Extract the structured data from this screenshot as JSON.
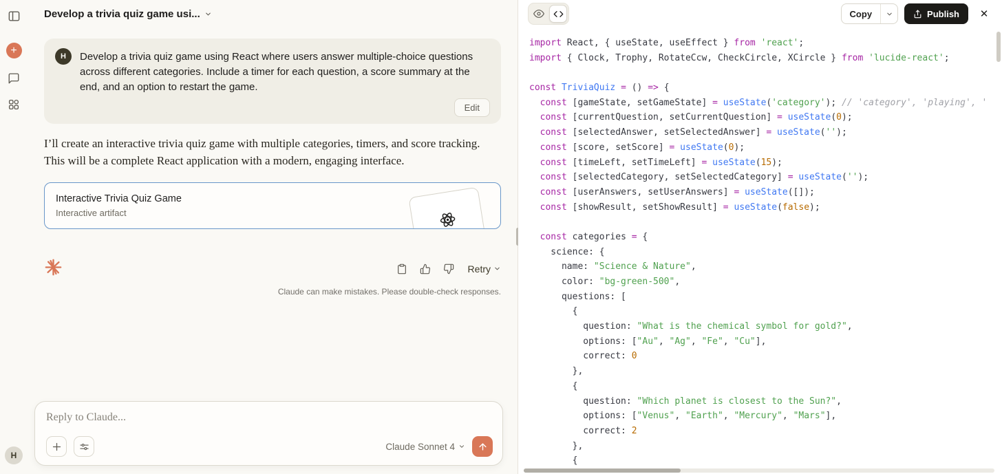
{
  "colors": {
    "accent": "#d97757",
    "artifact_border": "#6896c9",
    "publish_bg": "#1c1b18"
  },
  "icons": {
    "plus": "+",
    "close": "✕"
  },
  "rail": {
    "avatar_initial": "H"
  },
  "header": {
    "title": "Develop a trivia quiz game usi..."
  },
  "user_message": {
    "avatar": "H",
    "text": "Develop a trivia quiz game using React where users answer multiple-choice questions across different categories. Include a timer for each question, a score summary at the end, and an option to restart the game.",
    "edit_label": "Edit"
  },
  "assistant": {
    "intro": "I’ll create an interactive trivia quiz game with multiple categories, timers, and score tracking. This will be a complete React application with a modern, engaging interface.",
    "artifact_card": {
      "title": "Interactive Trivia Quiz Game",
      "subtitle": "Interactive artifact"
    },
    "retry_label": "Retry",
    "disclaimer": "Claude can make mistakes. Please double-check responses."
  },
  "composer": {
    "placeholder": "Reply to Claude...",
    "model": "Claude Sonnet 4"
  },
  "artifact_panel": {
    "copy_label": "Copy",
    "publish_label": "Publish",
    "code_lines": [
      [
        [
          "k",
          "import"
        ],
        [
          "p",
          " React, { useState, useEffect } "
        ],
        [
          "k",
          "from"
        ],
        [
          "p",
          " "
        ],
        [
          "s",
          "'react'"
        ],
        [
          "p",
          ";"
        ]
      ],
      [
        [
          "k",
          "import"
        ],
        [
          "p",
          " { Clock, Trophy, RotateCcw, CheckCircle, XCircle } "
        ],
        [
          "k",
          "from"
        ],
        [
          "p",
          " "
        ],
        [
          "s",
          "'lucide-react'"
        ],
        [
          "p",
          ";"
        ]
      ],
      [],
      [
        [
          "k",
          "const"
        ],
        [
          "p",
          " "
        ],
        [
          "f",
          "TriviaQuiz"
        ],
        [
          "p",
          " "
        ],
        [
          "o",
          "="
        ],
        [
          "p",
          " () "
        ],
        [
          "o",
          "=>"
        ],
        [
          "p",
          " {"
        ]
      ],
      [
        [
          "p",
          "  "
        ],
        [
          "k",
          "const"
        ],
        [
          "p",
          " [gameState, setGameState] "
        ],
        [
          "o",
          "="
        ],
        [
          "p",
          " "
        ],
        [
          "f",
          "useState"
        ],
        [
          "p",
          "("
        ],
        [
          "s",
          "'category'"
        ],
        [
          "p",
          "); "
        ],
        [
          "c",
          "// 'category', 'playing', '"
        ]
      ],
      [
        [
          "p",
          "  "
        ],
        [
          "k",
          "const"
        ],
        [
          "p",
          " [currentQuestion, setCurrentQuestion] "
        ],
        [
          "o",
          "="
        ],
        [
          "p",
          " "
        ],
        [
          "f",
          "useState"
        ],
        [
          "p",
          "("
        ],
        [
          "n",
          "0"
        ],
        [
          "p",
          ");"
        ]
      ],
      [
        [
          "p",
          "  "
        ],
        [
          "k",
          "const"
        ],
        [
          "p",
          " [selectedAnswer, setSelectedAnswer] "
        ],
        [
          "o",
          "="
        ],
        [
          "p",
          " "
        ],
        [
          "f",
          "useState"
        ],
        [
          "p",
          "("
        ],
        [
          "s",
          "''"
        ],
        [
          "p",
          ");"
        ]
      ],
      [
        [
          "p",
          "  "
        ],
        [
          "k",
          "const"
        ],
        [
          "p",
          " [score, setScore] "
        ],
        [
          "o",
          "="
        ],
        [
          "p",
          " "
        ],
        [
          "f",
          "useState"
        ],
        [
          "p",
          "("
        ],
        [
          "n",
          "0"
        ],
        [
          "p",
          ");"
        ]
      ],
      [
        [
          "p",
          "  "
        ],
        [
          "k",
          "const"
        ],
        [
          "p",
          " [timeLeft, setTimeLeft] "
        ],
        [
          "o",
          "="
        ],
        [
          "p",
          " "
        ],
        [
          "f",
          "useState"
        ],
        [
          "p",
          "("
        ],
        [
          "n",
          "15"
        ],
        [
          "p",
          ");"
        ]
      ],
      [
        [
          "p",
          "  "
        ],
        [
          "k",
          "const"
        ],
        [
          "p",
          " [selectedCategory, setSelectedCategory] "
        ],
        [
          "o",
          "="
        ],
        [
          "p",
          " "
        ],
        [
          "f",
          "useState"
        ],
        [
          "p",
          "("
        ],
        [
          "s",
          "''"
        ],
        [
          "p",
          ");"
        ]
      ],
      [
        [
          "p",
          "  "
        ],
        [
          "k",
          "const"
        ],
        [
          "p",
          " [userAnswers, setUserAnswers] "
        ],
        [
          "o",
          "="
        ],
        [
          "p",
          " "
        ],
        [
          "f",
          "useState"
        ],
        [
          "p",
          "([]);"
        ]
      ],
      [
        [
          "p",
          "  "
        ],
        [
          "k",
          "const"
        ],
        [
          "p",
          " [showResult, setShowResult] "
        ],
        [
          "o",
          "="
        ],
        [
          "p",
          " "
        ],
        [
          "f",
          "useState"
        ],
        [
          "p",
          "("
        ],
        [
          "n",
          "false"
        ],
        [
          "p",
          ");"
        ]
      ],
      [],
      [
        [
          "p",
          "  "
        ],
        [
          "k",
          "const"
        ],
        [
          "p",
          " categories "
        ],
        [
          "o",
          "="
        ],
        [
          "p",
          " {"
        ]
      ],
      [
        [
          "p",
          "    science: {"
        ]
      ],
      [
        [
          "p",
          "      name: "
        ],
        [
          "s",
          "\"Science & Nature\""
        ],
        [
          "p",
          ","
        ]
      ],
      [
        [
          "p",
          "      color: "
        ],
        [
          "s",
          "\"bg-green-500\""
        ],
        [
          "p",
          ","
        ]
      ],
      [
        [
          "p",
          "      questions: ["
        ]
      ],
      [
        [
          "p",
          "        {"
        ]
      ],
      [
        [
          "p",
          "          question: "
        ],
        [
          "s",
          "\"What is the chemical symbol for gold?\""
        ],
        [
          "p",
          ","
        ]
      ],
      [
        [
          "p",
          "          options: ["
        ],
        [
          "s",
          "\"Au\""
        ],
        [
          "p",
          ", "
        ],
        [
          "s",
          "\"Ag\""
        ],
        [
          "p",
          ", "
        ],
        [
          "s",
          "\"Fe\""
        ],
        [
          "p",
          ", "
        ],
        [
          "s",
          "\"Cu\""
        ],
        [
          "p",
          "],"
        ]
      ],
      [
        [
          "p",
          "          correct: "
        ],
        [
          "n",
          "0"
        ]
      ],
      [
        [
          "p",
          "        },"
        ]
      ],
      [
        [
          "p",
          "        {"
        ]
      ],
      [
        [
          "p",
          "          question: "
        ],
        [
          "s",
          "\"Which planet is closest to the Sun?\""
        ],
        [
          "p",
          ","
        ]
      ],
      [
        [
          "p",
          "          options: ["
        ],
        [
          "s",
          "\"Venus\""
        ],
        [
          "p",
          ", "
        ],
        [
          "s",
          "\"Earth\""
        ],
        [
          "p",
          ", "
        ],
        [
          "s",
          "\"Mercury\""
        ],
        [
          "p",
          ", "
        ],
        [
          "s",
          "\"Mars\""
        ],
        [
          "p",
          "],"
        ]
      ],
      [
        [
          "p",
          "          correct: "
        ],
        [
          "n",
          "2"
        ]
      ],
      [
        [
          "p",
          "        },"
        ]
      ],
      [
        [
          "p",
          "        {"
        ]
      ]
    ]
  }
}
